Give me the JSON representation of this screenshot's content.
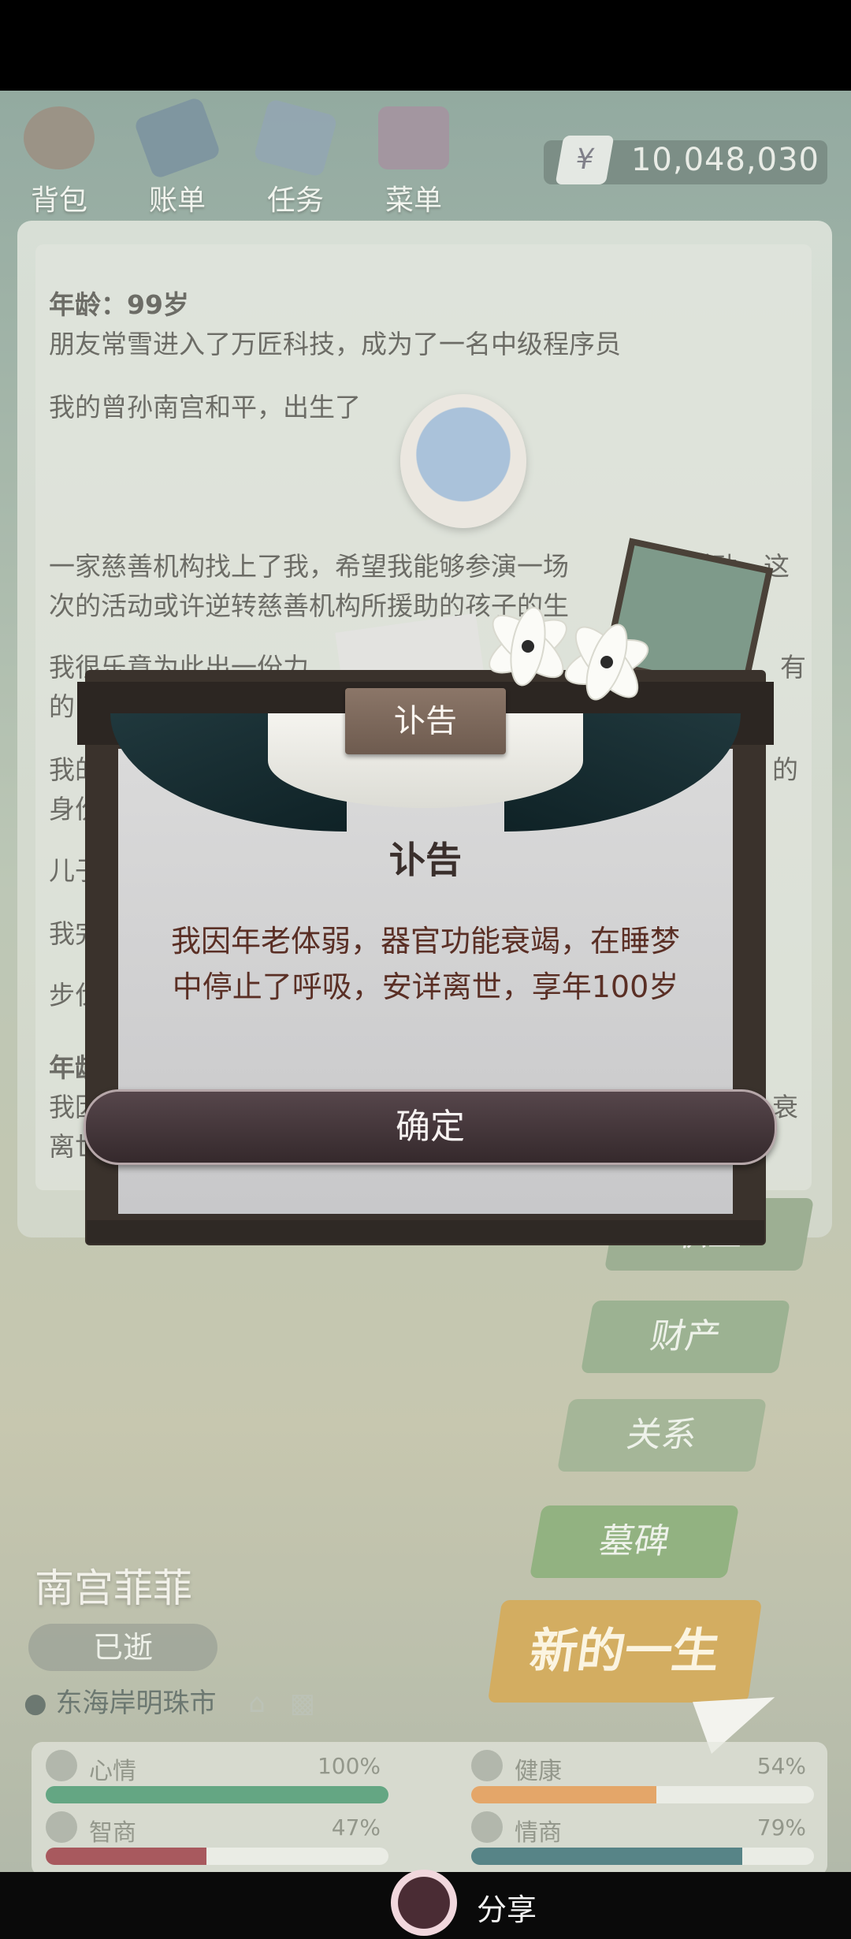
{
  "toolbar": {
    "items": [
      {
        "label": "背包"
      },
      {
        "label": "账单"
      },
      {
        "label": "任务"
      },
      {
        "label": "菜单"
      }
    ],
    "money_symbol": "¥",
    "money": "10,048,030"
  },
  "story": {
    "age_heading": "年龄：99岁",
    "lines": [
      "朋友常雪进入了万匠科技，成为了一名中级程序员",
      "我的曾孙南宫和平，出生了",
      "一家慈善机构找上了我，希望我能够参演一场",
      "活动，这",
      "次的活动或许逆转慈善机构所援助的孩子的生",
      "我很乐意为此出一份力",
      "有",
      "的",
      "我的",
      "的",
      "身份",
      "儿子",
      "我完",
      "步伐",
      "年龄",
      "我因",
      "衰",
      "离世"
    ]
  },
  "side_buttons": {
    "career": "职业",
    "assets": "财产",
    "relations": "关系",
    "tomb": "墓碑",
    "new_life": "新的一生"
  },
  "character": {
    "name": "南宫菲菲",
    "status": "已逝",
    "location": "东海岸明珠市"
  },
  "stats": [
    {
      "name": "心情",
      "percent": "100%",
      "value": 1.0,
      "color": "#2f8a5e"
    },
    {
      "name": "健康",
      "percent": "54%",
      "value": 0.54,
      "color": "#e0893a"
    },
    {
      "name": "智商",
      "percent": "47%",
      "value": 0.47,
      "color": "#8c1f2a"
    },
    {
      "name": "情商",
      "percent": "79%",
      "value": 0.79,
      "color": "#1d5a63"
    }
  ],
  "dialog": {
    "tab": "讣告",
    "title": "讣告",
    "message_line1": "我因年老体弱，器官功能衰竭，在睡梦",
    "message_line2": "中停止了呼吸，安详离世，享年100岁",
    "confirm": "确定"
  },
  "share": {
    "label": "分享"
  }
}
